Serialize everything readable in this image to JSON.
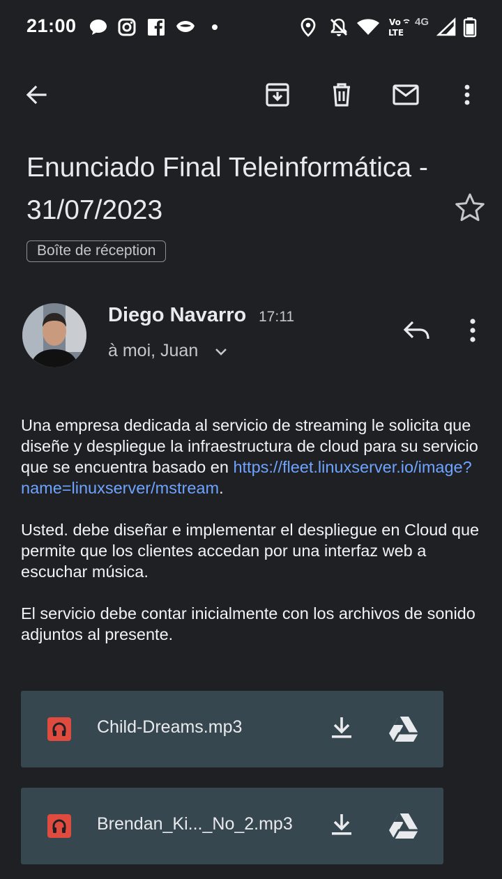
{
  "status_bar": {
    "time": "21:00",
    "network_label": "4G",
    "volte_top": "Vo",
    "volte_bottom": "LTE",
    "icons": [
      "chat-bubble-icon",
      "instagram-icon",
      "facebook-icon",
      "mask-app-icon",
      "dot-icon",
      "location-icon",
      "bell-off-icon",
      "wifi-icon",
      "volte-icon",
      "signal-icon",
      "battery-icon"
    ]
  },
  "toolbar": {
    "icons": [
      "back-arrow-icon",
      "archive-icon",
      "delete-icon",
      "mark-unread-icon",
      "more-vert-icon"
    ]
  },
  "email": {
    "subject": "Enunciado Final Teleinformática - 31/07/2023",
    "label": "Boîte de réception",
    "sender_name": "Diego Navarro",
    "time": "17:11",
    "recipients": "à moi, Juan",
    "body": {
      "p1": "Una empresa dedicada al servicio de streaming le solicita que diseñe y despliegue la infraestructura de cloud para su servicio que se encuentra basado en ",
      "link": "https://fleet.linuxserver.io/image?name=linuxserver/mstream",
      "p1_end": ".",
      "p2": "Usted.  debe diseñar e implementar el despliegue en Cloud que permite que los clientes accedan por una interfaz web a escuchar música.",
      "p3": "El servicio debe contar inicialmente con los  archivos de sonido adjuntos al presente."
    },
    "attachments": [
      {
        "name": "Child-Dreams.mp3"
      },
      {
        "name": "Brendan_Ki..._No_2.mp3"
      }
    ]
  },
  "colors": {
    "background": "#1f2023",
    "attachment_bg": "#37474f",
    "link": "#6ea4ff",
    "audio_icon": "#e04b3f"
  }
}
